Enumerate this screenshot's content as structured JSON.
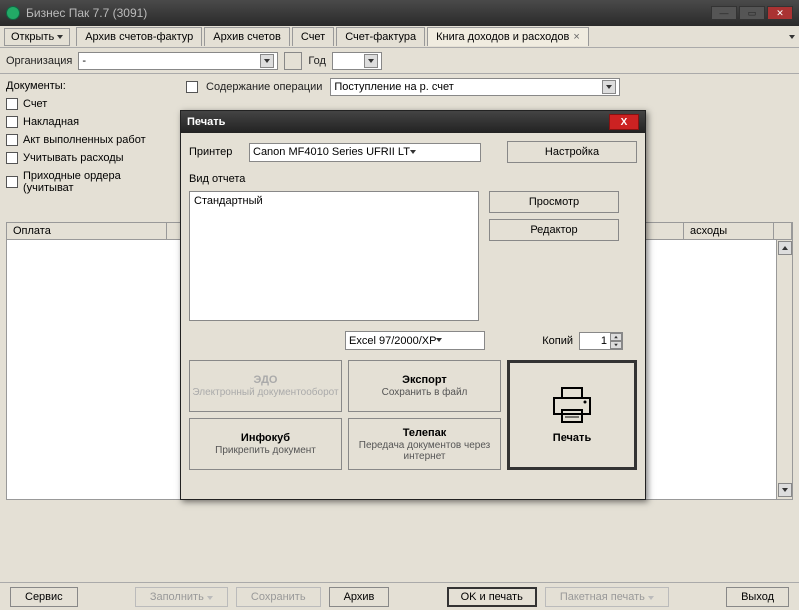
{
  "window": {
    "title": "Бизнес Пак 7.7 (3091)",
    "open_btn": "Открыть"
  },
  "tabs": {
    "t1": "Архив счетов-фактур",
    "t2": "Архив счетов",
    "t3": "Счет",
    "t4": "Счет-фактура",
    "t5": "Книга доходов и расходов"
  },
  "row2": {
    "org_label": "Организация",
    "org_value": "-",
    "year_label": "Год"
  },
  "left": {
    "docs_label": "Документы:",
    "chk1": "Счет",
    "chk2": "Накладная",
    "chk3": "Акт выполненных работ",
    "chk4": "Учитывать расходы",
    "chk5": "Приходные ордера (учитыват"
  },
  "op": {
    "label": "Содержание операции",
    "value": "Поступление на р. счет"
  },
  "grid": {
    "col1": "Оплата",
    "col2": "асходы"
  },
  "bottombar": {
    "service": "Сервис",
    "fill": "Заполнить",
    "save": "Сохранить",
    "archive": "Архив",
    "ok_print": "OK и печать",
    "batch": "Пакетная печать",
    "exit": "Выход"
  },
  "dialog": {
    "title": "Печать",
    "printer_label": "Принтер",
    "printer_value": "Canon MF4010 Series UFRII LT",
    "settings": "Настройка",
    "report_type_label": "Вид отчета",
    "report_item": "Стандартный",
    "preview": "Просмотр",
    "editor": "Редактор",
    "format": "Excel 97/2000/XP",
    "copies_label": "Копий",
    "copies_value": "1",
    "edo_t": "ЭДО",
    "edo_s": "Электронный документооборот",
    "export_t": "Экспорт",
    "export_s": "Сохранить в файл",
    "infokub_t": "Инфокуб",
    "infokub_s": "Прикрепить документ",
    "telepak_t": "Телепак",
    "telepak_s": "Передача документов через интернет",
    "print_label": "Печать"
  }
}
